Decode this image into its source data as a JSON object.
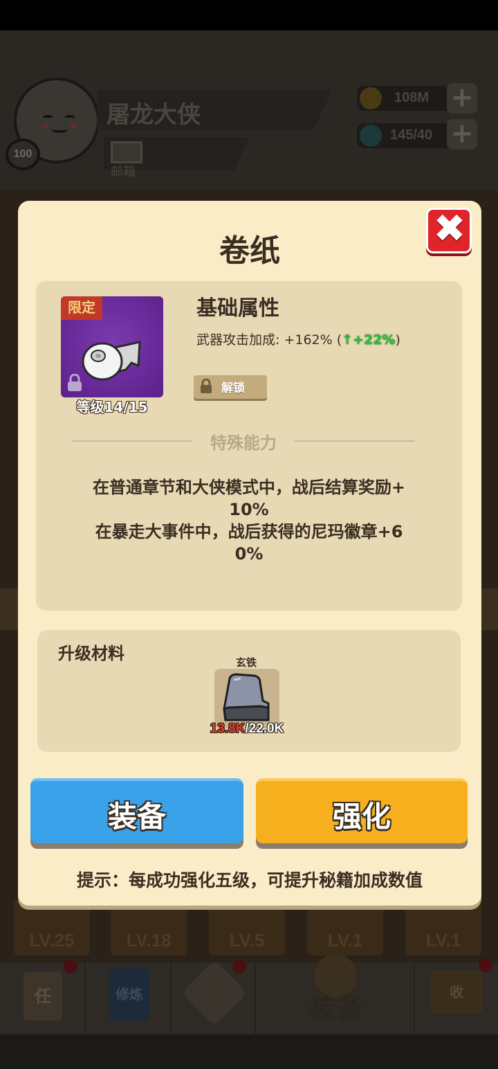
{
  "header": {
    "player_name": "屠龙大侠",
    "player_level": "100",
    "mail_label": "邮箱",
    "coins": "108M",
    "gems": "145/40"
  },
  "bottom_items": [
    {
      "lv": "LV.25"
    },
    {
      "lv": "LV.18"
    },
    {
      "lv": "LV.5"
    },
    {
      "lv": "LV.1"
    },
    {
      "lv": "LV.1"
    }
  ],
  "nav": {
    "mission_icon_text": "任",
    "cultivate_icon_text": "修炼",
    "equip_label": "装备",
    "collect_icon_text": "收"
  },
  "modal": {
    "title": "卷纸",
    "limited_tag": "限定",
    "level_text": "等级14/15",
    "attr_title": "基础属性",
    "attr_label": "武器攻击加成: +162% (",
    "attr_bonus": "↑+22%",
    "attr_close": ")",
    "unlock_label": "解锁",
    "special_title": "特殊能力",
    "special_lines": [
      "在普通章节和大侠模式中，战后结算奖励+",
      "10%",
      "在暴走大事件中，战后获得的尼玛徽章+6",
      "0%"
    ],
    "materials_title": "升级材料",
    "material": {
      "name": "玄铁",
      "have": "13.8K",
      "need": "/22.0K"
    },
    "equip_button": "装备",
    "enhance_button": "强化",
    "hint": "提示：每成功强化五级，可提升秘籍加成数值"
  },
  "colors": {
    "modal_bg": "#fbecc8",
    "panel_bg": "#e8d9b5",
    "equip_btn": "#39a2e8",
    "enhance_btn": "#f6b01d",
    "close_btn": "#e0252a",
    "item_purple": "#6a2b9c",
    "bonus_green": "#27c03a"
  }
}
